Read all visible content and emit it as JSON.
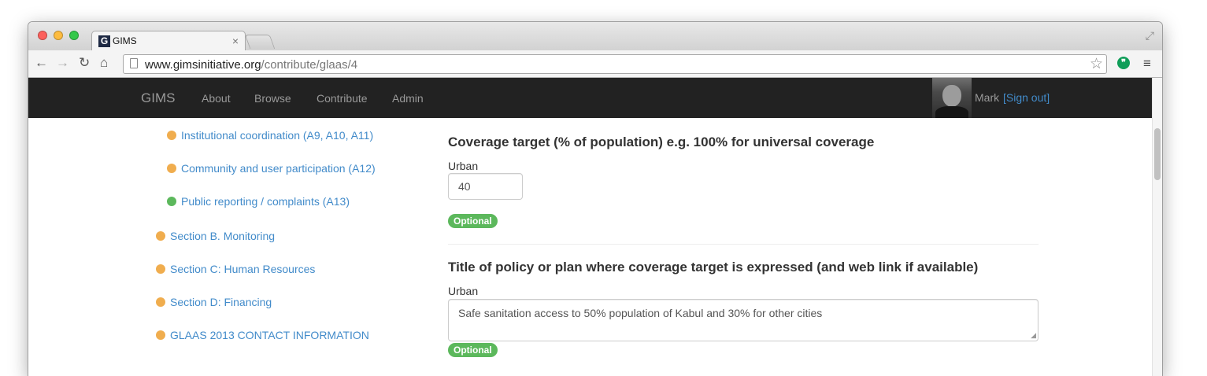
{
  "browser": {
    "tab_title": "GIMS",
    "tab_favicon_letter": "G",
    "tab_close": "×",
    "url_domain": "www.gimsinitiative.org",
    "url_path": "/contribute/glaas/4",
    "icons": {
      "back": "back-arrow-icon",
      "forward": "forward-arrow-icon",
      "reload": "reload-icon",
      "home": "home-icon",
      "bookmark": "star-icon",
      "extension": "hangouts-icon",
      "menu": "menu-icon",
      "fullscreen": "fullscreen-icon"
    }
  },
  "navbar": {
    "brand": "GIMS",
    "links": [
      "About",
      "Browse",
      "Contribute",
      "Admin"
    ],
    "user_name": "Mark",
    "sign_out": "[Sign out]"
  },
  "sidebar": {
    "items": [
      {
        "label": "Institutional coordination (A9, A10, A11)",
        "status": "orange"
      },
      {
        "label": "Community and user participation (A12)",
        "status": "orange"
      },
      {
        "label": "Public reporting / complaints (A13)",
        "status": "green"
      },
      {
        "label": "Section B. Monitoring",
        "status": "orange"
      },
      {
        "label": "Section C: Human Resources",
        "status": "orange"
      },
      {
        "label": "Section D: Financing",
        "status": "orange"
      },
      {
        "label": "GLAAS 2013 CONTACT INFORMATION",
        "status": "orange"
      }
    ]
  },
  "main": {
    "questions": [
      {
        "title": "Coverage target (% of population) e.g. 100% for universal coverage",
        "field_label": "Urban",
        "value": "40",
        "badge": "Optional"
      },
      {
        "title": "Title of policy or plan where coverage target is expressed (and web link if available)",
        "field_label": "Urban",
        "value": "Safe sanitation access to 50% population of Kabul and 30% for other cities",
        "badge": "Optional"
      }
    ]
  },
  "colors": {
    "link": "#428bca",
    "status_orange": "#f0ad4e",
    "status_green": "#5cb85c",
    "navbar_bg": "#222222"
  }
}
